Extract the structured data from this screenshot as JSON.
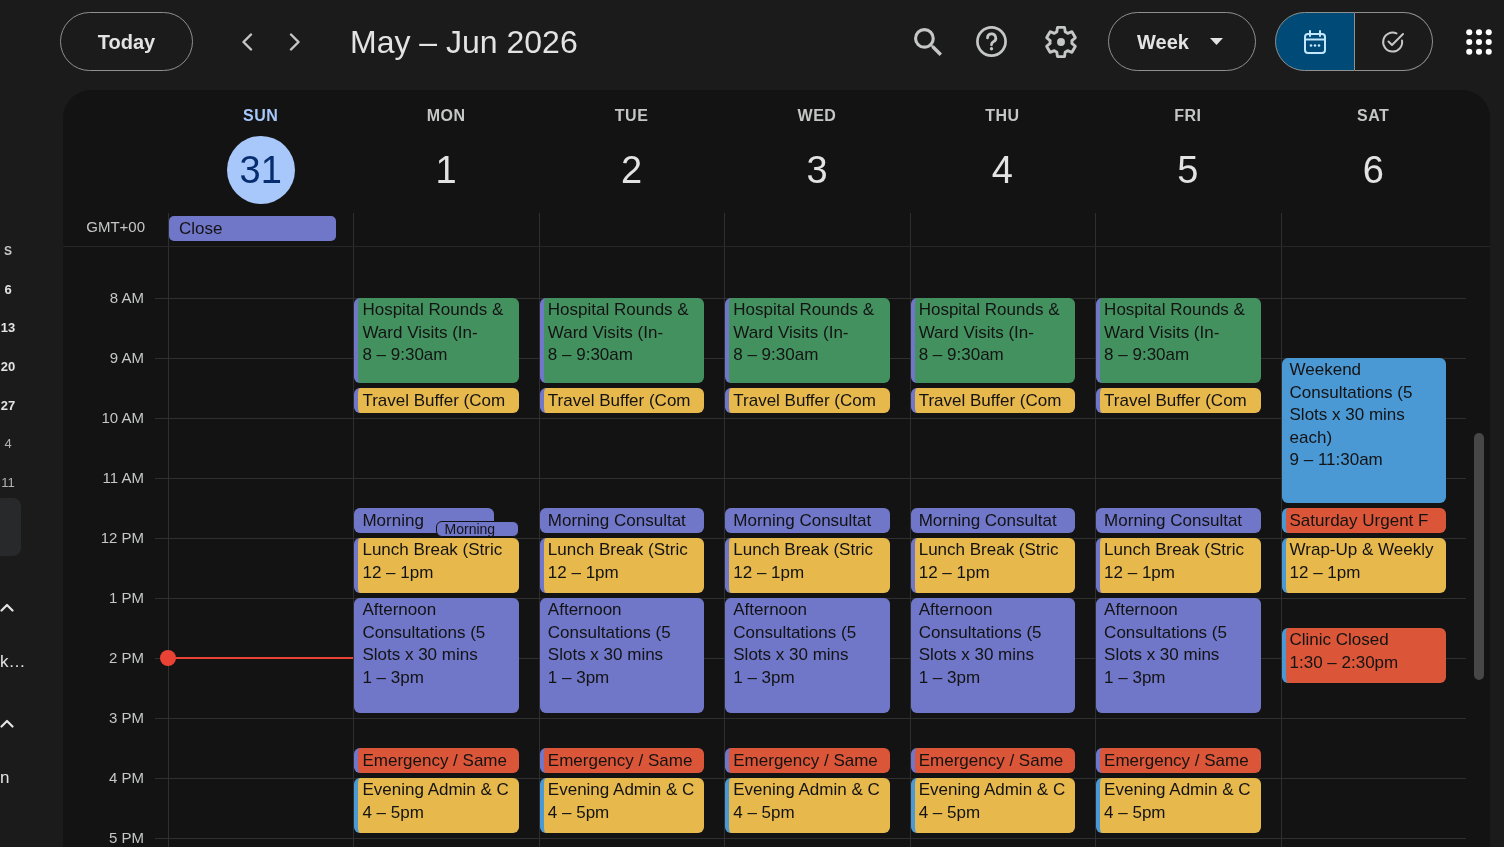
{
  "toolbar": {
    "today_button": "Today",
    "title": "May – Jun 2026",
    "view_dropdown": "Week",
    "view_toggle": [
      {
        "kind": "calendar",
        "selected": true
      },
      {
        "kind": "tasks",
        "selected": false
      }
    ]
  },
  "sidebar": {
    "mini_calendar": {
      "column_header": "S",
      "dates": [
        {
          "label": "6",
          "other_month": false
        },
        {
          "label": "13",
          "other_month": false
        },
        {
          "label": "20",
          "other_month": false
        },
        {
          "label": "27",
          "other_month": false
        },
        {
          "label": "4",
          "other_month": true
        },
        {
          "label": "11",
          "other_month": true
        }
      ]
    },
    "sections": [
      {
        "expanded": true,
        "items": [
          "k…"
        ]
      },
      {
        "expanded": true,
        "items": [
          "n"
        ]
      }
    ]
  },
  "timezone": "GMT+00",
  "time_labels": [
    {
      "label": "8 AM",
      "now": false
    },
    {
      "label": "9 AM",
      "now": false
    },
    {
      "label": "10 AM",
      "now": false
    },
    {
      "label": "11 AM",
      "now": false
    },
    {
      "label": "12 PM",
      "now": false
    },
    {
      "label": "1 PM",
      "now": false
    },
    {
      "label": "2 PM",
      "now": true
    },
    {
      "label": "3 PM",
      "now": false
    },
    {
      "label": "4 PM",
      "now": false
    },
    {
      "label": "5 PM",
      "now": false
    }
  ],
  "days": [
    {
      "name": "SUN",
      "date": "31",
      "selected": true,
      "all_day": [
        {
          "title": "Close",
          "color": "#7076c8"
        }
      ]
    },
    {
      "name": "MON",
      "date": "1",
      "selected": false,
      "events": [
        {
          "title": "Hospital Rounds & Ward Visits (In-",
          "time": "8 – 9:30am",
          "color": "#449160",
          "calendar": {
            "color": "#7076c8"
          },
          "after": [
            {
              "kind": "brief",
              "title": "Travel Buffer (Com",
              "color": "#e7b94d",
              "calendar": {
                "color": "#7076c8"
              }
            }
          ]
        },
        {
          "title": "Lunch Break (Stric",
          "time": "12 – 1pm",
          "color": "#e7b94d",
          "calendar": {
            "color": "#7076c8"
          },
          "before": [
            {
              "kind": "brief",
              "title": "Morning",
              "color": "#7076c8"
            },
            {
              "kind": "mini",
              "title": "Morning",
              "color": "#7076c8"
            }
          ]
        },
        {
          "title": "Afternoon Consultations (5 Slots x 30 mins",
          "time": "1 – 3pm",
          "color": "#7076c8"
        },
        {
          "title": "Evening Admin & C",
          "time": "4 – 5pm",
          "color": "#e7b94d",
          "calendar": {
            "color": "#4a98d4"
          },
          "before": [
            {
              "kind": "brief",
              "title": "Emergency / Same",
              "color": "#db5638",
              "calendar": {
                "color": "#7076c8"
              }
            }
          ]
        }
      ]
    },
    {
      "name": "TUE",
      "date": "2",
      "selected": false,
      "events": [
        {
          "title": "Hospital Rounds & Ward Visits (In-",
          "time": "8 – 9:30am",
          "color": "#449160",
          "calendar": {
            "color": "#7076c8"
          },
          "after": [
            {
              "kind": "brief",
              "title": "Travel Buffer (Com",
              "color": "#e7b94d",
              "calendar": {
                "color": "#7076c8"
              }
            }
          ]
        },
        {
          "title": "Lunch Break (Stric",
          "time": "12 – 1pm",
          "color": "#e7b94d",
          "calendar": {
            "color": "#7076c8"
          },
          "before": [
            {
              "kind": "brief",
              "title": "Morning Consultat",
              "color": "#7076c8"
            }
          ]
        },
        {
          "title": "Afternoon Consultations (5 Slots x 30 mins",
          "time": "1 – 3pm",
          "color": "#7076c8"
        },
        {
          "title": "Evening Admin & C",
          "time": "4 – 5pm",
          "color": "#e7b94d",
          "calendar": {
            "color": "#4a98d4"
          },
          "before": [
            {
              "kind": "brief",
              "title": "Emergency / Same",
              "color": "#db5638",
              "calendar": {
                "color": "#7076c8"
              }
            }
          ]
        }
      ]
    },
    {
      "name": "WED",
      "date": "3",
      "selected": false,
      "events": [
        {
          "title": "Hospital Rounds & Ward Visits (In-",
          "time": "8 – 9:30am",
          "color": "#449160",
          "calendar": {
            "color": "#7076c8"
          },
          "after": [
            {
              "kind": "brief",
              "title": "Travel Buffer (Com",
              "color": "#e7b94d",
              "calendar": {
                "color": "#7076c8"
              }
            }
          ]
        },
        {
          "title": "Lunch Break (Stric",
          "time": "12 – 1pm",
          "color": "#e7b94d",
          "calendar": {
            "color": "#7076c8"
          },
          "before": [
            {
              "kind": "brief",
              "title": "Morning Consultat",
              "color": "#7076c8"
            }
          ]
        },
        {
          "title": "Afternoon Consultations (5 Slots x 30 mins",
          "time": "1 – 3pm",
          "color": "#7076c8"
        },
        {
          "title": "Evening Admin & C",
          "time": "4 – 5pm",
          "color": "#e7b94d",
          "calendar": {
            "color": "#4a98d4"
          },
          "before": [
            {
              "kind": "brief",
              "title": "Emergency / Same",
              "color": "#db5638",
              "calendar": {
                "color": "#7076c8"
              }
            }
          ]
        }
      ]
    },
    {
      "name": "THU",
      "date": "4",
      "selected": false,
      "events": [
        {
          "title": "Hospital Rounds & Ward Visits (In-",
          "time": "8 – 9:30am",
          "color": "#449160",
          "calendar": {
            "color": "#7076c8"
          },
          "after": [
            {
              "kind": "brief",
              "title": "Travel Buffer (Com",
              "color": "#e7b94d",
              "calendar": {
                "color": "#7076c8"
              }
            }
          ]
        },
        {
          "title": "Lunch Break (Stric",
          "time": "12 – 1pm",
          "color": "#e7b94d",
          "calendar": {
            "color": "#7076c8"
          },
          "before": [
            {
              "kind": "brief",
              "title": "Morning Consultat",
              "color": "#7076c8"
            }
          ]
        },
        {
          "title": "Afternoon Consultations (5 Slots x 30 mins",
          "time": "1 – 3pm",
          "color": "#7076c8"
        },
        {
          "title": "Evening Admin & C",
          "time": "4 – 5pm",
          "color": "#e7b94d",
          "calendar": {
            "color": "#4a98d4"
          },
          "before": [
            {
              "kind": "brief",
              "title": "Emergency / Same",
              "color": "#db5638",
              "calendar": {
                "color": "#7076c8"
              }
            }
          ]
        }
      ]
    },
    {
      "name": "FRI",
      "date": "5",
      "selected": false,
      "events": [
        {
          "title": "Hospital Rounds & Ward Visits (In-",
          "time": "8 – 9:30am",
          "color": "#449160",
          "calendar": {
            "color": "#7076c8"
          },
          "after": [
            {
              "kind": "brief",
              "title": "Travel Buffer (Com",
              "color": "#e7b94d",
              "calendar": {
                "color": "#7076c8"
              }
            }
          ]
        },
        {
          "title": "Lunch Break (Stric",
          "time": "12 – 1pm",
          "color": "#e7b94d",
          "calendar": {
            "color": "#7076c8"
          },
          "before": [
            {
              "kind": "brief",
              "title": "Morning Consultat",
              "color": "#7076c8"
            }
          ]
        },
        {
          "title": "Afternoon Consultations (5 Slots x 30 mins",
          "time": "1 – 3pm",
          "color": "#7076c8"
        },
        {
          "title": "Evening Admin & C",
          "time": "4 – 5pm",
          "color": "#e7b94d",
          "calendar": {
            "color": "#4a98d4"
          },
          "before": [
            {
              "kind": "brief",
              "title": "Emergency / Same",
              "color": "#db5638",
              "calendar": {
                "color": "#7076c8"
              }
            }
          ]
        }
      ]
    },
    {
      "name": "SAT",
      "date": "6",
      "selected": false,
      "events": [
        {
          "title": "Weekend Consultations (5 Slots x 30 mins each)",
          "time": "9 – 11:30am",
          "color": "#4a98d4"
        },
        {
          "title": "Wrap-Up & Weekly",
          "time": "12 – 1pm",
          "color": "#e7b94d",
          "calendar": {
            "color": "#4a98d4"
          },
          "before": [
            {
              "kind": "brief",
              "title": "Saturday Urgent F",
              "color": "#db5638",
              "calendar": {
                "color": "#4a98d4"
              }
            }
          ]
        },
        {
          "title": "Clinic Closed",
          "time": "1:30 – 2:30pm",
          "color": "#db5638",
          "calendar": {
            "color": "#4a98d4"
          }
        }
      ]
    }
  ]
}
